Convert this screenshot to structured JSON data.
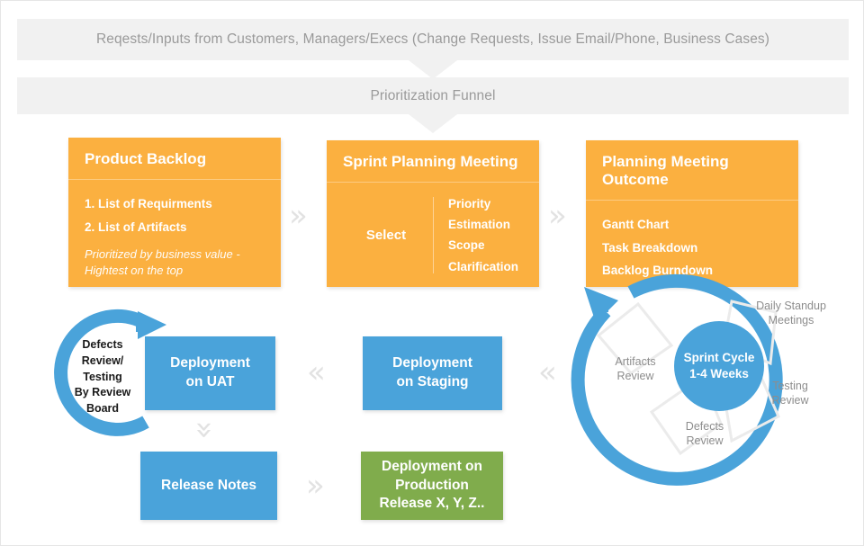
{
  "colors": {
    "orange": "#fbb040",
    "blue": "#4aa3da",
    "green": "#80ac4c",
    "banner_bg": "#f1f1f1",
    "banner_text": "#9a9a9a",
    "chevron": "#e2e2e2",
    "petal_outline": "#ebebeb"
  },
  "banners": [
    {
      "label": "Reqests/Inputs from Customers, Managers/Execs (Change Requests, Issue Email/Phone, Business Cases)"
    },
    {
      "label": "Prioritization Funnel"
    }
  ],
  "orange_cards": {
    "product_backlog": {
      "title": "Product Backlog",
      "items": [
        "1. List of Requirments",
        "2. List of Artifacts"
      ],
      "note": "Prioritized by business value - Hightest on the top"
    },
    "sprint_planning": {
      "title": "Sprint Planning Meeting",
      "select_label": "Select",
      "items": [
        "Priority",
        "Estimation",
        "Scope",
        "Clarification"
      ]
    },
    "planning_outcome": {
      "title": "Planning Meeting Outcome",
      "items": [
        "Gantt Chart",
        "Task Breakdown",
        "Backlog Burndown"
      ]
    }
  },
  "process_boxes": {
    "deployment_uat": "Deployment\non UAT",
    "deployment_uat_l1": "Deployment",
    "deployment_uat_l2": "on UAT",
    "deployment_staging_l1": "Deployment",
    "deployment_staging_l2": "on Staging",
    "release_notes": "Release Notes",
    "deployment_production_l1": "Deployment on",
    "deployment_production_l2": "Production",
    "deployment_production_l3": "Release X, Y, Z.."
  },
  "left_ring": {
    "label_l1": "Defects",
    "label_l2": "Review/",
    "label_l3": "Testing",
    "label_l4": "By Review",
    "label_l5": "Board"
  },
  "sprint_cycle": {
    "center_l1": "Sprint Cycle",
    "center_l2": "1-4 Weeks",
    "labels": [
      {
        "l1": "Daily Standup",
        "l2": "Meetings"
      },
      {
        "l1": "Testing",
        "l2": "Review"
      },
      {
        "l1": "Defects",
        "l2": "Review"
      },
      {
        "l1": "Artifacts",
        "l2": "Review"
      }
    ]
  },
  "arrows": {
    "right_chevron": "»",
    "left_chevron": "«",
    "down_chevron": "»"
  }
}
